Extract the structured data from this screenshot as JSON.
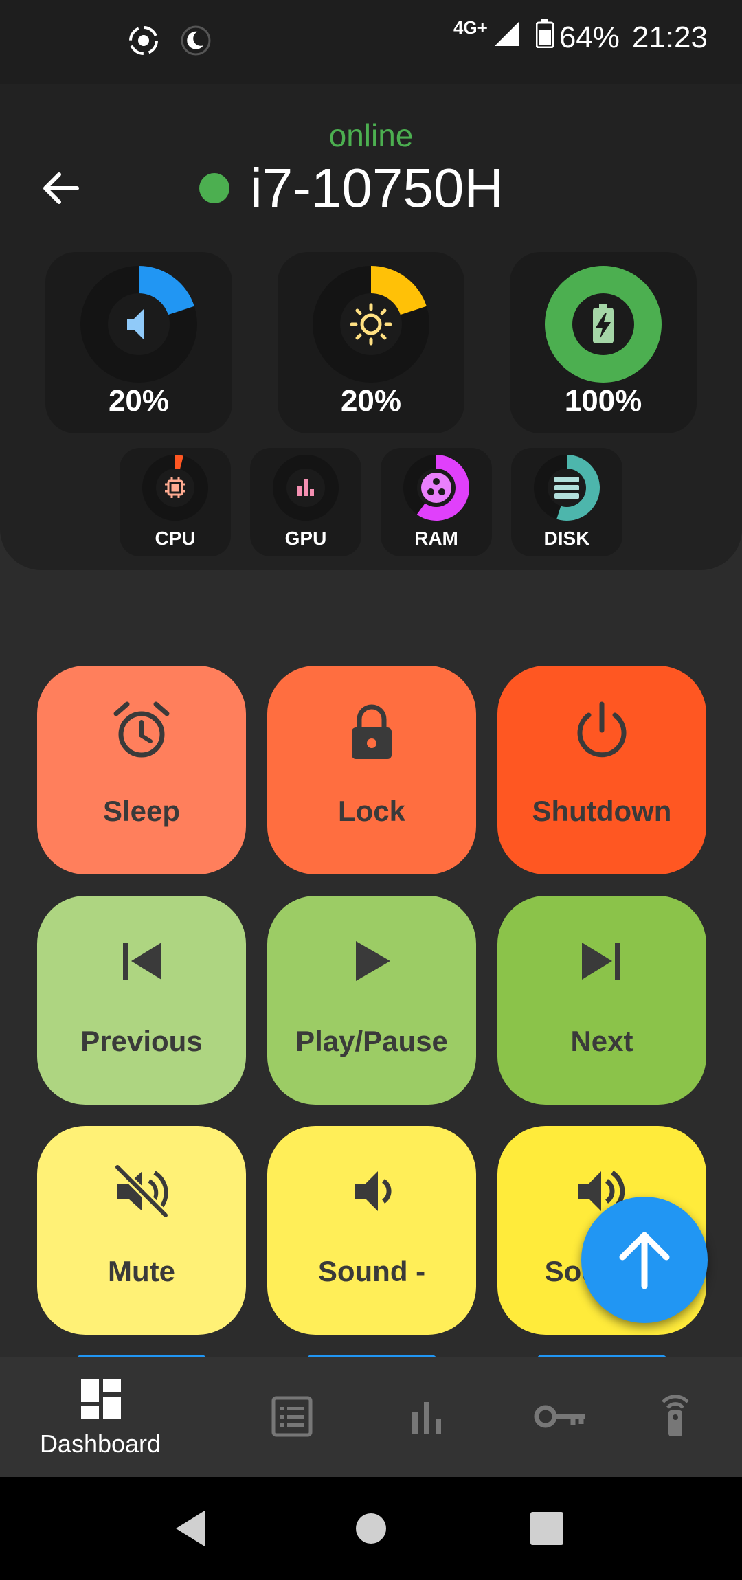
{
  "status_bar": {
    "network": "4G+",
    "battery": "64%",
    "time": "21:23",
    "icons": [
      "screen-record-icon",
      "do-not-disturb-moon-icon",
      "signal-icon",
      "battery-icon"
    ]
  },
  "header": {
    "status": "online",
    "device_name": "i7-10750H",
    "status_color": "#4caf50"
  },
  "gauges": [
    {
      "name": "volume",
      "icon": "volume-icon",
      "value": "20%",
      "level": 0.2,
      "color": "#2196f3"
    },
    {
      "name": "brightness",
      "icon": "brightness-icon",
      "value": "20%",
      "level": 0.2,
      "color": "#ffc107"
    },
    {
      "name": "battery",
      "icon": "battery-charging-icon",
      "value": "100%",
      "level": 1.0,
      "color": "#4caf50"
    }
  ],
  "resources": [
    {
      "label": "CPU",
      "icon": "cpu-icon",
      "level": 0.04,
      "color": "#ff5722"
    },
    {
      "label": "GPU",
      "icon": "gpu-bars-icon",
      "level": 0.0,
      "color": "#f48fb1"
    },
    {
      "label": "RAM",
      "icon": "ram-icon",
      "level": 0.6,
      "color": "#e040fb"
    },
    {
      "label": "DISK",
      "icon": "disk-icon",
      "level": 0.55,
      "color": "#4db6ac"
    }
  ],
  "actions": [
    {
      "label": "Sleep",
      "icon": "alarm-clock-icon",
      "color": "#ff7f5c"
    },
    {
      "label": "Lock",
      "icon": "lock-icon",
      "color": "#ff6e40"
    },
    {
      "label": "Shutdown",
      "icon": "power-icon",
      "color": "#ff5722"
    },
    {
      "label": "Previous",
      "icon": "skip-previous-icon",
      "color": "#aed581"
    },
    {
      "label": "Play/Pause",
      "icon": "play-icon",
      "color": "#9ccc65"
    },
    {
      "label": "Next",
      "icon": "skip-next-icon",
      "color": "#8bc34a"
    },
    {
      "label": "Mute",
      "icon": "volume-off-icon",
      "color": "#fff176"
    },
    {
      "label": "Sound -",
      "icon": "volume-down-icon",
      "color": "#ffee58"
    },
    {
      "label": "Sound +",
      "icon": "volume-up-icon",
      "color": "#ffeb3b"
    }
  ],
  "fab": {
    "icon": "arrow-up-icon",
    "color": "#2196f3"
  },
  "bottom_nav": {
    "items": [
      {
        "label": "Dashboard",
        "icon": "dashboard-icon",
        "active": true
      },
      {
        "label": "",
        "icon": "list-icon",
        "active": false
      },
      {
        "label": "",
        "icon": "bar-chart-icon",
        "active": false
      },
      {
        "label": "",
        "icon": "key-icon",
        "active": false
      },
      {
        "label": "",
        "icon": "remote-icon",
        "active": false
      }
    ]
  },
  "system_nav": [
    "back-triangle-icon",
    "home-circle-icon",
    "recents-square-icon"
  ]
}
